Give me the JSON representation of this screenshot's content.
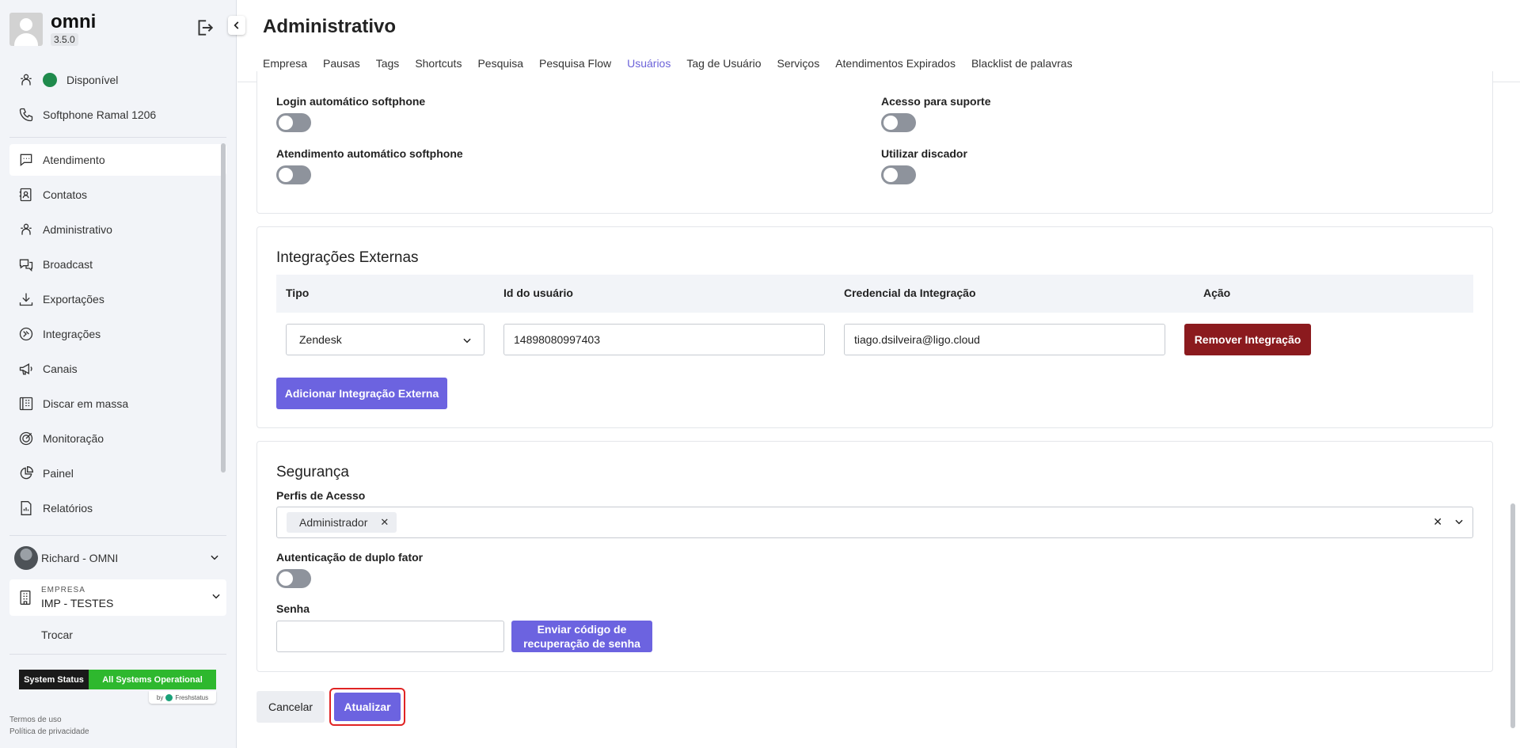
{
  "app": {
    "name": "omni",
    "version": "3.5.0"
  },
  "sidebar": {
    "status": {
      "label": "Disponível",
      "color": "#1f8a4c"
    },
    "softphone": "Softphone Ramal 1206",
    "items": [
      {
        "label": "Atendimento",
        "icon": "chat-icon"
      },
      {
        "label": "Contatos",
        "icon": "contacts-icon"
      },
      {
        "label": "Administrativo",
        "icon": "admin-icon"
      },
      {
        "label": "Broadcast",
        "icon": "broadcast-icon"
      },
      {
        "label": "Exportações",
        "icon": "download-icon"
      },
      {
        "label": "Integrações",
        "icon": "integrations-icon"
      },
      {
        "label": "Canais",
        "icon": "megaphone-icon"
      },
      {
        "label": "Discar em massa",
        "icon": "dialer-icon"
      },
      {
        "label": "Monitoração",
        "icon": "target-icon"
      },
      {
        "label": "Painel",
        "icon": "pie-chart-icon"
      },
      {
        "label": "Relatórios",
        "icon": "report-icon"
      }
    ],
    "user": "Richard - OMNI",
    "company_label": "EMPRESA",
    "company_name": "IMP - TESTES",
    "switch_label": "Trocar",
    "system_status": {
      "left": "System Status",
      "right": "All Systems Operational",
      "by": "by",
      "provider": "Freshstatus"
    },
    "terms": "Termos de uso",
    "privacy": "Política de privacidade"
  },
  "page": {
    "title": "Administrativo",
    "tabs": [
      "Empresa",
      "Pausas",
      "Tags",
      "Shortcuts",
      "Pesquisa",
      "Pesquisa Flow",
      "Usuários",
      "Tag de Usuário",
      "Serviços",
      "Atendimentos Expirados",
      "Blacklist de palavras"
    ],
    "active_tab": "Usuários"
  },
  "toggles": {
    "login_auto": "Login automático softphone",
    "atendimento_auto": "Atendimento automático softphone",
    "acesso_suporte": "Acesso para suporte",
    "discador": "Utilizar discador"
  },
  "integrations": {
    "title": "Integrações Externas",
    "headers": {
      "tipo": "Tipo",
      "id": "Id do usuário",
      "credencial": "Credencial da Integração",
      "acao": "Ação"
    },
    "rows": [
      {
        "tipo": "Zendesk",
        "id": "14898080997403",
        "credencial": "tiago.dsilveira@ligo.cloud",
        "acao": "Remover Integração"
      }
    ],
    "add_button": "Adicionar Integração Externa"
  },
  "security": {
    "title": "Segurança",
    "profiles_label": "Perfis de Acesso",
    "profiles": [
      "Administrador"
    ],
    "twofa_label": "Autenticação de duplo fator",
    "password_label": "Senha",
    "password_value": "",
    "send_code_button": "Enviar código de recuperação de senha"
  },
  "actions": {
    "cancel": "Cancelar",
    "update": "Atualizar"
  }
}
